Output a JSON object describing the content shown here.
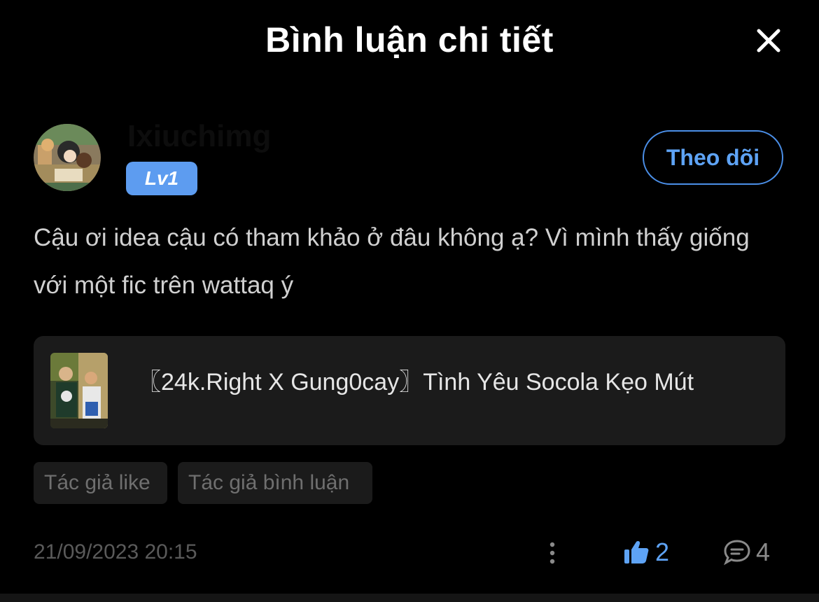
{
  "header": {
    "title": "Bình luận chi tiết"
  },
  "author": {
    "username": "Ixiuchimg",
    "level": "Lv1",
    "follow_label": "Theo dõi"
  },
  "comment": {
    "text": "Cậu ơi idea cậu có tham khảo ở đâu không ạ? Vì mình thấy giống với một fic trên wattaq ý"
  },
  "story": {
    "title": "〖24k.Right X Gung0cay〗Tình Yêu Socola Kẹo Mút"
  },
  "tags": [
    "Tác giả like",
    "Tác giả bình luận"
  ],
  "footer": {
    "timestamp": "21/09/2023 20:15",
    "like_count": "2",
    "reply_count": "4"
  },
  "colors": {
    "accent": "#5ea3f5",
    "badge": "#5d9cf0",
    "card": "#1b1b1b",
    "background": "#000000"
  },
  "icons": {
    "close": "close-icon",
    "more": "more-vertical-icon",
    "like": "thumbs-up-icon",
    "reply": "comment-bubble-icon"
  }
}
